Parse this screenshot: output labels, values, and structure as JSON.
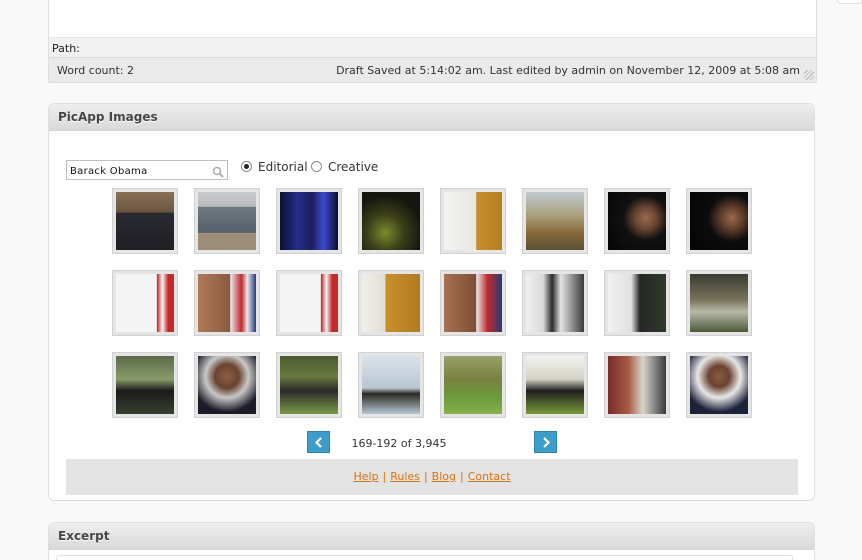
{
  "editor": {
    "path_label": "Path:",
    "word_count": "Word count: 2",
    "draft_status": "Draft Saved at 5:14:02 am. Last edited by admin on November 12, 2009 at 5:08 am"
  },
  "picapp": {
    "title": "PicApp Images",
    "search_value": "Barack Obama",
    "radio_options": [
      {
        "label": "Editorial",
        "selected": true
      },
      {
        "label": "Creative",
        "selected": false
      }
    ],
    "pagination": "169-192 of 3,945",
    "footer_links": [
      "Help",
      "Rules",
      "Blog",
      "Contact"
    ]
  },
  "excerpt": {
    "title": "Excerpt"
  },
  "colors": {
    "accent": "#3e9ccc",
    "link": "#d9730d"
  },
  "icons": {
    "search": "search-icon",
    "prev": "chevron-left-icon",
    "next": "chevron-right-icon"
  }
}
